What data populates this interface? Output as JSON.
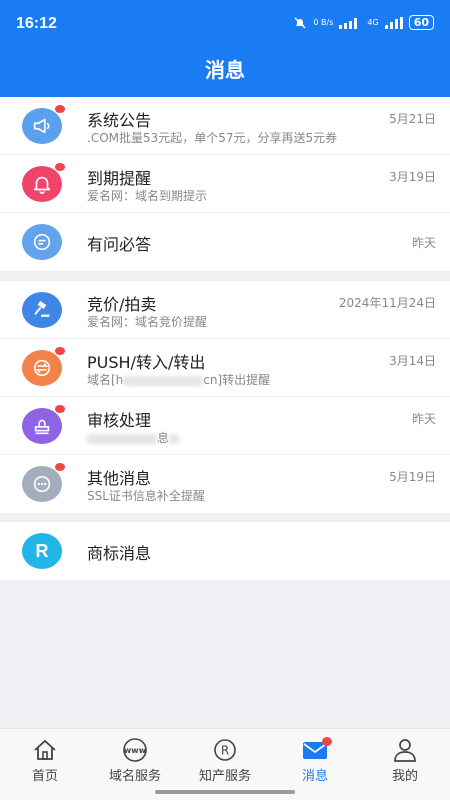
{
  "status_bar": {
    "time": "16:12",
    "net_speed": "0 B/s",
    "network": "4G",
    "battery": "60"
  },
  "header": {
    "title": "消息"
  },
  "groups": [
    {
      "items": [
        {
          "icon": "megaphone-icon",
          "color": "#5aa0ee",
          "badge": true,
          "title": "系统公告",
          "subtitle": ".COM批量53元起，单个57元，分享再送5元券",
          "date": "5月21日"
        },
        {
          "icon": "bell-icon",
          "color": "#f0456a",
          "badge": true,
          "title": "到期提醒",
          "subtitle": "爱名网：域名到期提示",
          "date": "3月19日"
        },
        {
          "icon": "chat-bubble-icon",
          "color": "#62a4ec",
          "badge": false,
          "title": "有问必答",
          "subtitle": "",
          "date": "昨天"
        }
      ]
    },
    {
      "items": [
        {
          "icon": "gavel-icon",
          "color": "#3f86e6",
          "badge": false,
          "title": "竞价/拍卖",
          "subtitle": "爱名网：域名竞价提醒",
          "date": "2024年11月24日"
        },
        {
          "icon": "transfer-icon",
          "color": "#f3824a",
          "badge": true,
          "title": "PUSH/转入/转出",
          "subtitle_prefix": "域名[h",
          "subtitle_suffix": "cn]转出提醒",
          "date": "3月14日"
        },
        {
          "icon": "stamp-icon",
          "color": "#8d64e3",
          "badge": true,
          "title": "审核处理",
          "subtitle": "息",
          "date": "昨天"
        },
        {
          "icon": "more-icon",
          "color": "#a3adbb",
          "badge": true,
          "title": "其他消息",
          "subtitle": "SSL证书信息补全提醒",
          "date": "5月19日"
        }
      ]
    },
    {
      "items": [
        {
          "icon": "trademark-r-icon",
          "color": "#22b6e8",
          "badge": false,
          "title": "商标消息",
          "subtitle": "",
          "date": ""
        }
      ]
    }
  ],
  "tabbar": {
    "active": "消息",
    "tabs": [
      {
        "label": "首页",
        "icon": "home-icon"
      },
      {
        "label": "域名服务",
        "icon": "www-icon"
      },
      {
        "label": "知产服务",
        "icon": "registered-icon"
      },
      {
        "label": "消息",
        "icon": "envelope-icon",
        "badge": true
      },
      {
        "label": "我的",
        "icon": "person-icon"
      }
    ]
  }
}
